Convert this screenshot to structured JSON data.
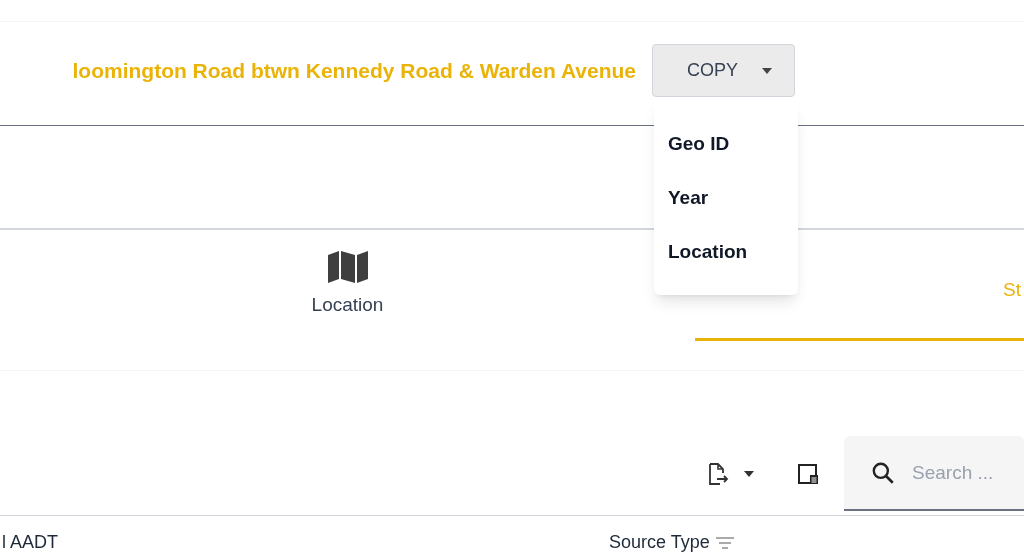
{
  "header": {
    "title": "loomington Road btwn Kennedy Road & Warden Avenue",
    "copy_button": "COPY"
  },
  "copy_menu": {
    "items": [
      {
        "label": "Geo ID"
      },
      {
        "label": "Year"
      },
      {
        "label": "Location"
      }
    ]
  },
  "tabs": [
    {
      "label": "Location",
      "selected": false,
      "kind": "icon"
    },
    {
      "label": "St",
      "selected": true,
      "kind": "text"
    }
  ],
  "toolbar": {
    "search": {
      "placeholder": "Search ..."
    }
  },
  "table": {
    "columns": [
      {
        "label": "l AADT",
        "filter": false
      },
      {
        "label": "Source Type",
        "filter": true
      }
    ]
  }
}
